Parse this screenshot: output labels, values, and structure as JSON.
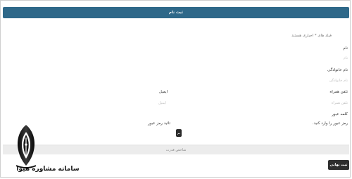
{
  "form": {
    "top_button_label": "ثبت نام",
    "required_hint": "فیلد های * اجباری هستند",
    "required_star": "*",
    "first_name_label": "نام",
    "first_name_placeholder": "نام",
    "last_name_label": "نام خانوادگی",
    "last_name_placeholder": "نام خانوادگی",
    "mobile_label": "تلفن همراه",
    "mobile_placeholder": "تلفن همراه",
    "email_label": "ایمیل",
    "email_placeholder": "ایمیل",
    "password_label": "کلمه عبور",
    "password_placeholder": "رمز عبور را وارد کنید.",
    "confirm_password_label": "تائید رمز عبور",
    "show_password_label": "نم",
    "strength_label": "شاخص قدرت",
    "final_button_label": "ثبت نهایی"
  },
  "watermark": {
    "logo_icon": "pen-nib-icon",
    "text": "سامانه مشاوره هیوا"
  },
  "colors": {
    "primary": "#2e6889",
    "dark_button": "#2e2e2e",
    "strength_bar": "#ececec"
  }
}
